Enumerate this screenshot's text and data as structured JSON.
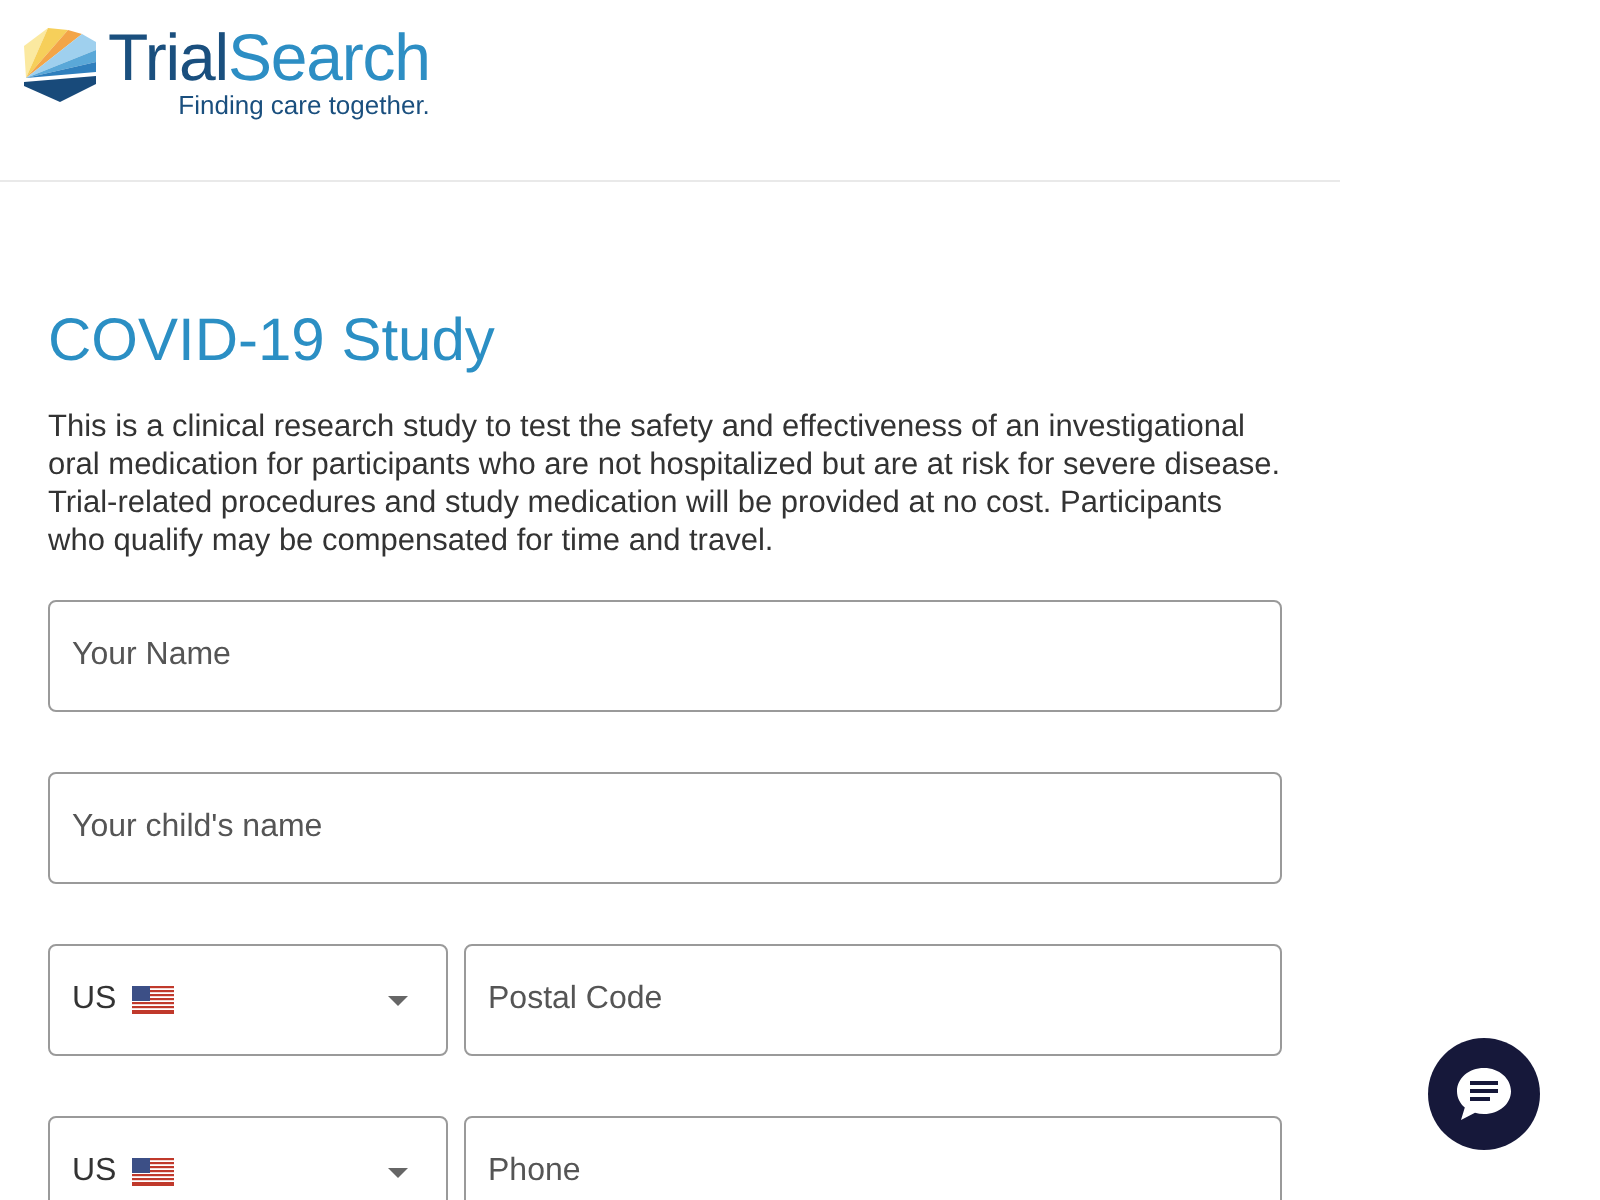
{
  "header": {
    "logo": {
      "wordmark_parts": [
        "Trial",
        "Search"
      ],
      "tagline": "Finding care together."
    }
  },
  "study": {
    "title": "COVID-19 Study",
    "description": "This is a clinical research study to test the safety and effectiveness of an investigational oral medication for participants who are not hospitalized but are at risk for severe disease. Trial-related procedures and study medication will be provided at no cost. Participants who qualify may be compensated for time and travel."
  },
  "form": {
    "rows": [
      {
        "kind": "text",
        "placeholder": "Your Name"
      },
      {
        "kind": "text",
        "placeholder": "Your child's name"
      },
      {
        "kind": "country_text",
        "country": "US",
        "placeholder": "Postal Code"
      },
      {
        "kind": "country_text",
        "country": "US",
        "placeholder": "Phone"
      }
    ]
  }
}
